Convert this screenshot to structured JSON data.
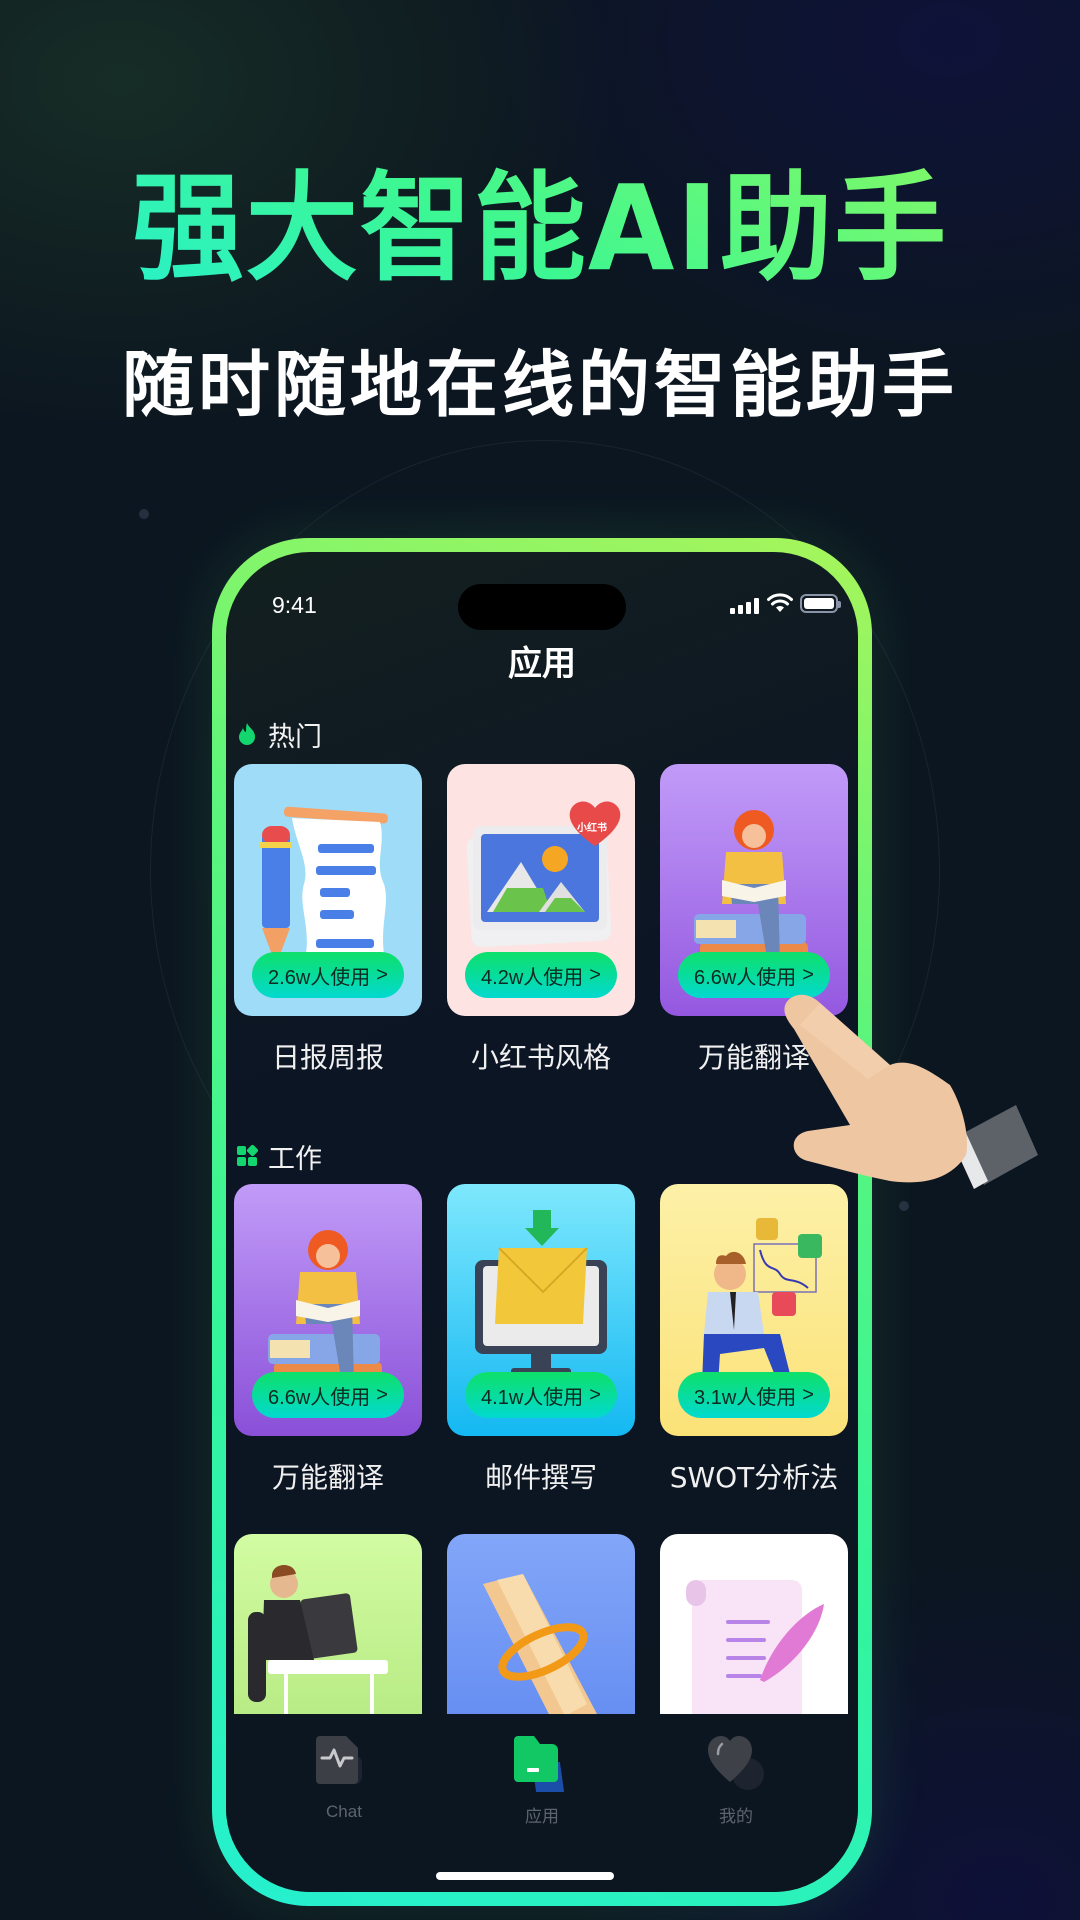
{
  "headline": "强大智能AI助手",
  "subheadline": "随时随地在线的智能助手",
  "phone": {
    "status_bar": {
      "time": "9:41"
    },
    "page_title": "应用",
    "sections": [
      {
        "title": "热门",
        "icon": "flame-icon",
        "cards": [
          {
            "name": "日报周报",
            "usage": "2.6w人使用",
            "art": "pencil-document",
            "bg": "#9fdcf8"
          },
          {
            "name": "小红书风格",
            "usage": "4.2w人使用",
            "art": "photo-heart",
            "bg": "#fde3e2",
            "badge": "小红书"
          },
          {
            "name": "万能翻译",
            "usage": "6.6w人使用",
            "art": "reader-books",
            "bg": "#a67ce8"
          }
        ]
      },
      {
        "title": "工作",
        "icon": "grid-apps-icon",
        "cards": [
          {
            "name": "万能翻译",
            "usage": "6.6w人使用",
            "art": "reader-books",
            "bg": "#a67ce8"
          },
          {
            "name": "邮件撰写",
            "usage": "4.1w人使用",
            "art": "envelope-monitor",
            "bg": "#4fd0f5"
          },
          {
            "name": "SWOT分析法",
            "usage": "3.1w人使用",
            "art": "businessman-chart",
            "bg": "#fdeb9a"
          }
        ]
      },
      {
        "title": "",
        "cards": [
          {
            "art": "man-at-desk",
            "bg": "#c6f29a"
          },
          {
            "art": "scroll-rope",
            "bg": "#6f97f3"
          },
          {
            "art": "quill-paper",
            "bg": "#ffffff"
          }
        ]
      }
    ],
    "usage_chevron": ">",
    "tabbar": {
      "active_index": 1,
      "active_color": "#12c864",
      "items": [
        {
          "label": "Chat",
          "icon": "pulse-document-icon"
        },
        {
          "label": "应用",
          "icon": "folder-icon"
        },
        {
          "label": "我的",
          "icon": "heart-icon"
        }
      ]
    }
  }
}
